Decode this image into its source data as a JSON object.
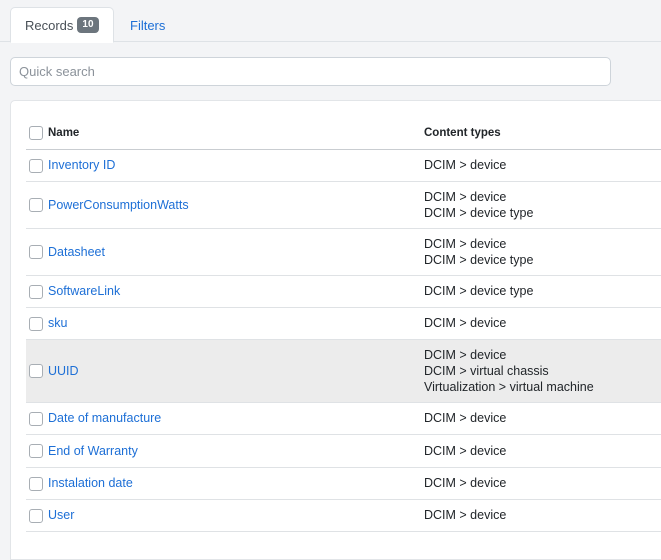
{
  "tabs": [
    {
      "label": "Records",
      "badge": "10"
    },
    {
      "label": "Filters"
    }
  ],
  "search": {
    "placeholder": "Quick search"
  },
  "table": {
    "headers": {
      "name": "Name",
      "content_types": "Content types"
    },
    "rows": [
      {
        "name": "Inventory ID",
        "content_types": [
          "DCIM > device"
        ]
      },
      {
        "name": "PowerConsumptionWatts",
        "content_types": [
          "DCIM > device",
          "DCIM > device type"
        ]
      },
      {
        "name": "Datasheet",
        "content_types": [
          "DCIM > device",
          "DCIM > device type"
        ]
      },
      {
        "name": "SoftwareLink",
        "content_types": [
          "DCIM > device type"
        ]
      },
      {
        "name": "sku",
        "content_types": [
          "DCIM > device"
        ]
      },
      {
        "name": "UUID",
        "content_types": [
          "DCIM > device",
          "DCIM > virtual chassis",
          "Virtualization > virtual machine"
        ]
      },
      {
        "name": "Date of manufacture",
        "content_types": [
          "DCIM > device"
        ]
      },
      {
        "name": "End of Warranty",
        "content_types": [
          "DCIM > device"
        ]
      },
      {
        "name": "Instalation date",
        "content_types": [
          "DCIM > device"
        ]
      },
      {
        "name": "User",
        "content_types": [
          "DCIM > device"
        ]
      }
    ]
  }
}
